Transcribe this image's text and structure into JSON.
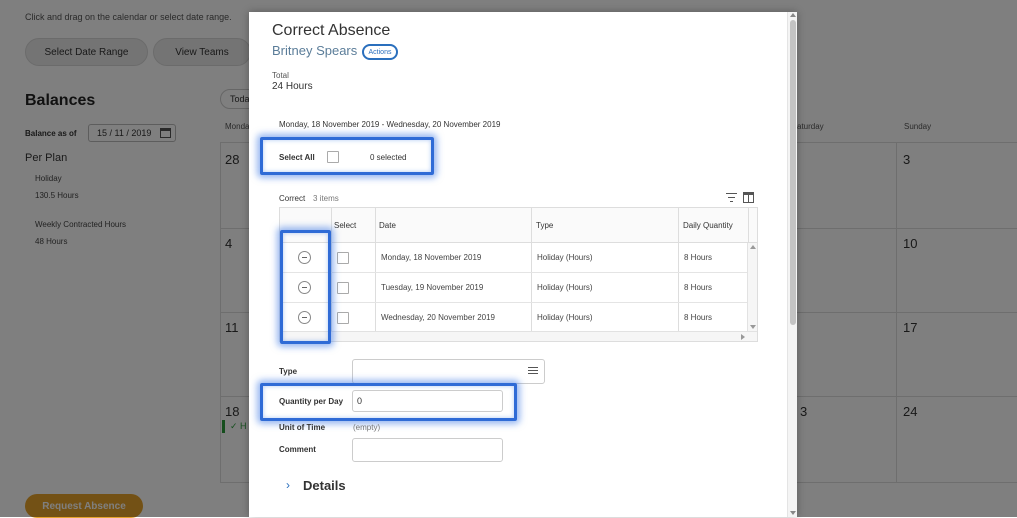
{
  "background": {
    "hint": "Click and drag on the calendar or select date range.",
    "select_date_range": "Select Date Range",
    "view_teams": "View Teams",
    "balances_title": "Balances",
    "balance_as_of_label": "Balance as of",
    "balance_as_of_value": "15 / 11 / 2019",
    "per_plan": "Per Plan",
    "plans": [
      {
        "name": "Holiday",
        "value": "130.5 Hours"
      },
      {
        "name": "Weekly Contracted Hours",
        "value": "48 Hours"
      }
    ],
    "today": "Toda",
    "day_headers": {
      "monday": "Monda",
      "saturday": "aturday",
      "sunday": "Sunday"
    },
    "calendar_numbers": {
      "r1a": "28",
      "r1b": "3",
      "r2a": "4",
      "r2b": "10",
      "r3a": "11",
      "r3b": "17",
      "r4a": "18",
      "r4b": "3",
      "r4c": "24"
    },
    "event_text": "✓ H",
    "request_absence": "Request Absence"
  },
  "modal": {
    "title": "Correct Absence",
    "worker": "Britney Spears",
    "actions": "Actions",
    "total_label": "Total",
    "total_value": "24 Hours",
    "date_range": "Monday, 18 November 2019 - Wednesday, 20 November 2019",
    "select_all_label": "Select All",
    "selected_count": "0 selected",
    "grid": {
      "title": "Correct",
      "count": "3 items",
      "headers": {
        "select": "Select",
        "date": "Date",
        "type": "Type",
        "daily_quantity": "Daily Quantity"
      },
      "rows": [
        {
          "date": "Monday, 18 November 2019",
          "type": "Holiday (Hours)",
          "qty": "8 Hours"
        },
        {
          "date": "Tuesday, 19 November 2019",
          "type": "Holiday (Hours)",
          "qty": "8 Hours"
        },
        {
          "date": "Wednesday, 20 November 2019",
          "type": "Holiday (Hours)",
          "qty": "8 Hours"
        }
      ]
    },
    "fields": {
      "type_label": "Type",
      "type_value": "",
      "quantity_label": "Quantity per Day",
      "quantity_value": "0",
      "unit_label": "Unit of Time",
      "unit_value": "(empty)",
      "comment_label": "Comment",
      "comment_value": ""
    },
    "details": "Details"
  },
  "colors": {
    "accent": "#2a6fbd",
    "highlight": "#2f6bd6",
    "request_button": "#e6a32b"
  }
}
